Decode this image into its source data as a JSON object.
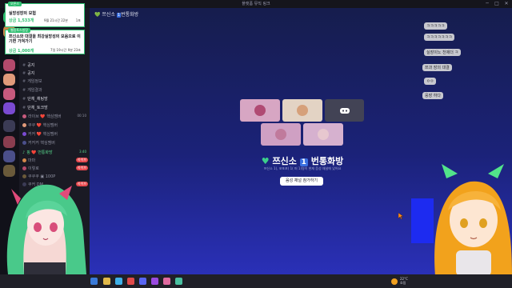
{
  "window": {
    "title": "플랫폼 뮤직 링크",
    "minimize": "─",
    "maximize": "□",
    "close": "✕"
  },
  "popups": [
    {
      "tag": "오픈스",
      "title": "실망성장의 모험",
      "date": "9월 21시간 22분",
      "extra": "1포",
      "price": "상금 1,533개"
    },
    {
      "tag": "웹밍토스방장",
      "title": "쯔신소와 대결을 최강실망성의 모음으로 이기면 가져가기",
      "date": "7일 19시간",
      "extra": "9분 23초",
      "price": "상금 1,000개"
    }
  ],
  "channels": [
    {
      "label": "공지",
      "style": "bright"
    },
    {
      "label": "공지",
      "style": "bright"
    },
    {
      "label": "게임정보",
      "style": "normal"
    },
    {
      "label": "게임결과",
      "style": "normal"
    },
    {
      "label": "단체_채팅방",
      "style": "bright"
    },
    {
      "label": "단체_토크방",
      "style": "bright"
    },
    {
      "label": "라이브 ❤️ 핵심멤버",
      "style": "normal",
      "badge": "00:10"
    },
    {
      "label": "쿠쿠 ❤️ 핵심멤버",
      "style": "normal"
    },
    {
      "label": "커커 ❤️ 핵심멤버",
      "style": "normal"
    },
    {
      "label": "커커커 핵심멤버",
      "style": "normal"
    },
    {
      "label": "핑 ❤️ 번통화방",
      "style": "green",
      "badge": "3:40"
    },
    {
      "label": "마마",
      "style": "normal",
      "badge": "라이브"
    },
    {
      "label": "이렇로",
      "style": "normal",
      "badge": "라이브"
    },
    {
      "label": "쿠쿠쿠 ▣ 100P",
      "style": "normal"
    },
    {
      "label": "쿠커 DM",
      "style": "normal",
      "badge": "라이브"
    }
  ],
  "topic": {
    "heart": "💚",
    "name": "쯔신소",
    "num": "1",
    "suffix": "번통화방"
  },
  "voice": {
    "title_name": "쯔신소",
    "title_num": "1",
    "title_suffix": "번통화방",
    "subtitle": "쯔신소 1(, 포포포) 1( 퍼 1)명이 현재 음성 채널에 있어요",
    "join_label": "음성 채널 참가하기",
    "discord_icon": "discord-icon"
  },
  "chat": [
    "ㅋㅋㅋㅋㅋ",
    "ㅋㅋㅋㅋㅋㅋㅋ",
    "실장이노 천제더 ㅋ",
    "쯔과 장의 대결",
    "ㅇㅇ",
    "웅장 하다"
  ],
  "taskbar": {
    "weather": "22°C",
    "weather_sub": "흐림"
  },
  "colors": {
    "accent_green": "#2fbf71",
    "blurple": "#5865f2",
    "live_red": "#e5484d"
  }
}
